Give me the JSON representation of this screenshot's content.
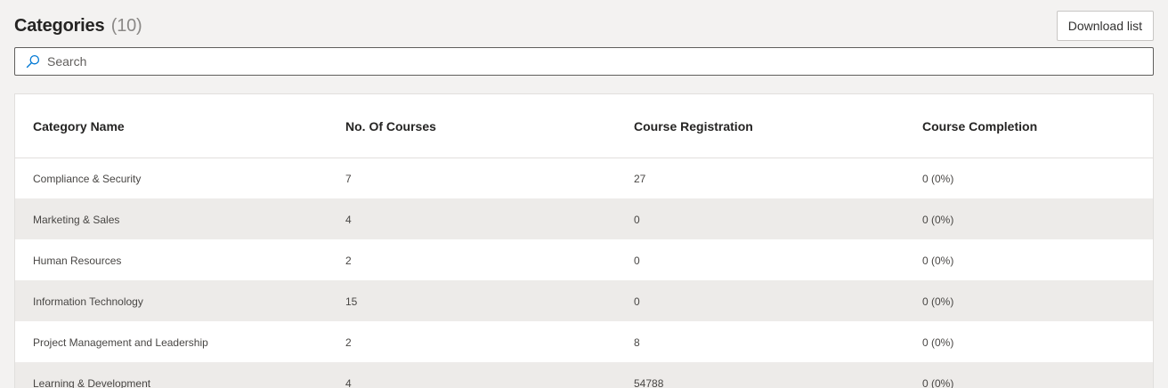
{
  "header": {
    "title": "Categories",
    "count": "(10)",
    "download_label": "Download list"
  },
  "search": {
    "placeholder": "Search",
    "icon": "search-icon"
  },
  "table": {
    "columns": [
      "Category Name",
      "No. Of Courses",
      "Course Registration",
      "Course Completion"
    ],
    "rows": [
      [
        "Compliance & Security",
        "7",
        "27",
        "0 (0%)"
      ],
      [
        "Marketing & Sales",
        "4",
        "0",
        "0 (0%)"
      ],
      [
        "Human Resources",
        "2",
        "0",
        "0 (0%)"
      ],
      [
        "Information Technology",
        "15",
        "0",
        "0 (0%)"
      ],
      [
        "Project Management and Leadership",
        "2",
        "8",
        "0 (0%)"
      ],
      [
        "Learning & Development",
        "4",
        "54788",
        "0 (0%)"
      ]
    ]
  },
  "colors": {
    "page_bg": "#f3f2f1",
    "row_alt": "#edebe9",
    "search_icon": "#0078d4"
  }
}
